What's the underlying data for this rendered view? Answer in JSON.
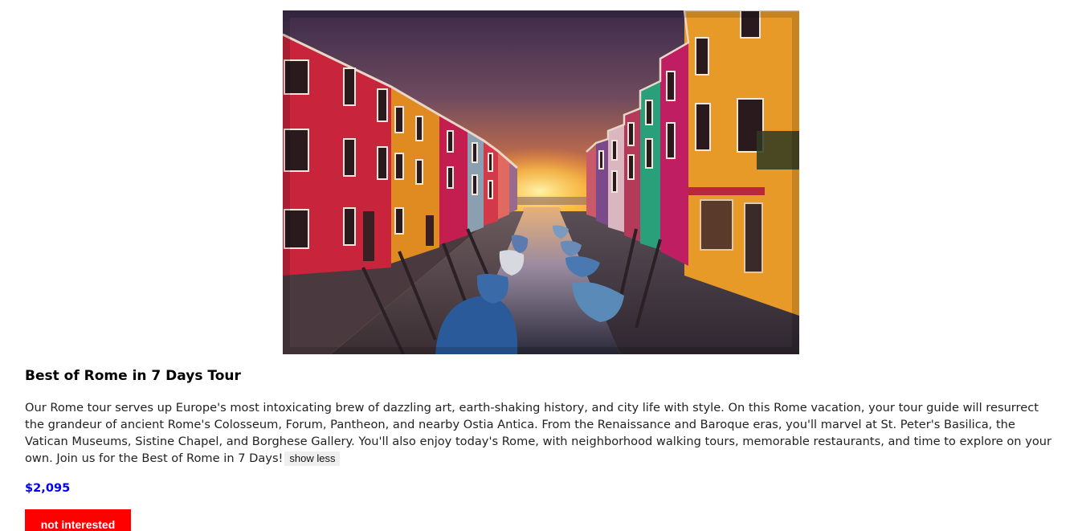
{
  "tour": {
    "image_subject": "canal-sunset-photo",
    "title": "Best of Rome in 7 Days Tour",
    "description": "Our Rome tour serves up Europe's most intoxicating brew of dazzling art, earth-shaking history, and city life with style. On this Rome vacation, your tour guide will resurrect the grandeur of ancient Rome's Colosseum, Forum, Pantheon, and nearby Ostia Antica. From the Renaissance and Baroque eras, you'll marvel at St. Peter's Basilica, the Vatican Museums, Sistine Chapel, and Borghese Gallery. You'll also enjoy today's Rome, with neighborhood walking tours, memorable restaurants, and time to explore on your own. Join us for the Best of Rome in 7 Days!",
    "toggle_label": "show less",
    "price": "$2,095",
    "not_interested_label": "not interested"
  },
  "colors": {
    "price": "#0000ee",
    "not_interested_bg": "#ff0000",
    "not_interested_text": "#ffffff",
    "toggle_bg": "#efefef"
  }
}
